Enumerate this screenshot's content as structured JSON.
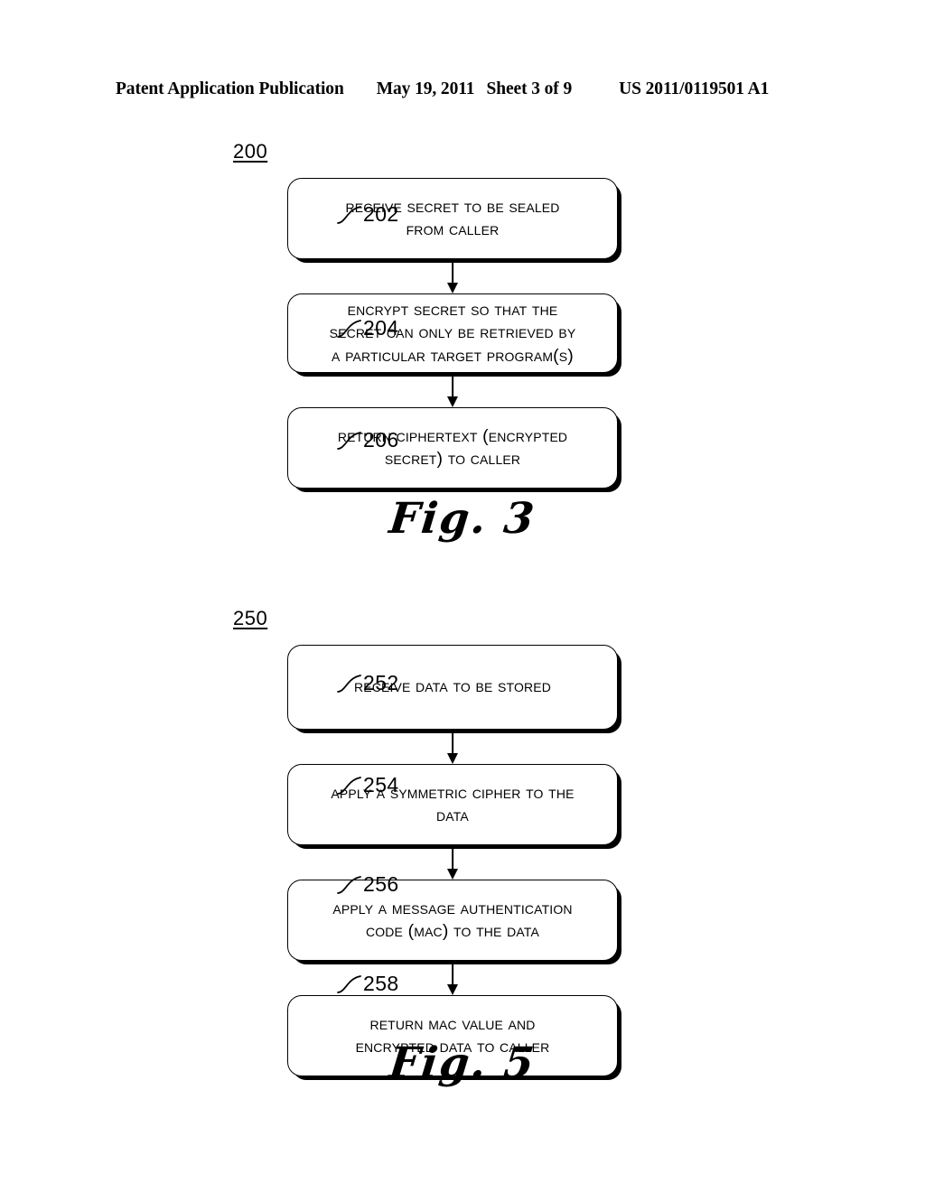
{
  "header": {
    "publication": "Patent Application Publication",
    "date": "May 19, 2011",
    "sheet": "Sheet 3 of 9",
    "number": "US 2011/0119501 A1"
  },
  "figures": [
    {
      "flow_label": "200",
      "caption": "Fig. 3",
      "nodes": [
        {
          "ref": "202",
          "text": "Receive Secret to be Sealed\nfrom Caller"
        },
        {
          "ref": "204",
          "text": "Encrypt Secret so that the\nSecret can Only be Retrieved by\na Particular Target Program(s)"
        },
        {
          "ref": "206",
          "text": "Return Ciphertext (Encrypted\nSecret) to Caller"
        }
      ]
    },
    {
      "flow_label": "250",
      "caption": "Fig. 5",
      "nodes": [
        {
          "ref": "252",
          "text": "Receive Data to be Stored"
        },
        {
          "ref": "254",
          "text": "Apply a Symmetric Cipher to the\nData"
        },
        {
          "ref": "256",
          "text": "Apply a Message Authentication\nCode (MAC) to the Data"
        },
        {
          "ref": "258",
          "text": "Return MAC Value and\nEncrypted Data to Caller"
        }
      ]
    }
  ],
  "colors": {
    "ink": "#000000",
    "paper": "#ffffff"
  }
}
